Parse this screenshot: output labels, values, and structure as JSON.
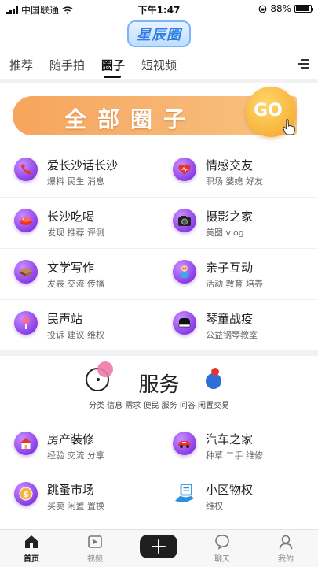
{
  "status": {
    "carrier": "中国联通",
    "time": "下午1:47",
    "battery": "88%",
    "battery_level": 0.88
  },
  "app": {
    "logo_text": "星辰圈"
  },
  "tabs": [
    {
      "label": "推荐"
    },
    {
      "label": "随手拍"
    },
    {
      "label": "圈子"
    },
    {
      "label": "短视频"
    }
  ],
  "active_tab": "圈子",
  "banner": {
    "title": "全部圈子",
    "go_label": "GO"
  },
  "circles": [
    {
      "title": "爱长沙话长沙",
      "tags": "爆料 民生 消息",
      "icon": "phone-icon"
    },
    {
      "title": "情感交友",
      "tags": "职场 婆媳 好友",
      "icon": "heart-icon"
    },
    {
      "title": "长沙吃喝",
      "tags": "发现 推荐 评测",
      "icon": "food-icon"
    },
    {
      "title": "摄影之家",
      "tags": "美图 vlog",
      "icon": "camera-icon"
    },
    {
      "title": "文学写作",
      "tags": "发表 交流 传播",
      "icon": "book-icon"
    },
    {
      "title": "亲子互动",
      "tags": "活动 教育 培养",
      "icon": "child-icon"
    },
    {
      "title": "民声站",
      "tags": "投诉 建议 维权",
      "icon": "microphone-icon"
    },
    {
      "title": "琴童战疫",
      "tags": "公益钢琴教室",
      "icon": "piano-icon"
    }
  ],
  "service": {
    "title": "服务",
    "subtitle": "分类 信息 需求 便民 服务 问答 闲置交易"
  },
  "services": [
    {
      "title": "房产装修",
      "tags": "经验 交流 分享",
      "icon": "house-icon"
    },
    {
      "title": "汽车之家",
      "tags": "种草 二手 维修",
      "icon": "car-icon"
    },
    {
      "title": "跳蚤市场",
      "tags": "买卖 闲置 置换",
      "icon": "coin-icon"
    },
    {
      "title": "小区物权",
      "tags": "维权",
      "icon": "property-icon"
    }
  ],
  "bottom_nav": [
    {
      "label": "首页",
      "icon": "home-icon"
    },
    {
      "label": "视频",
      "icon": "video-icon"
    },
    {
      "label": "",
      "icon": "plus-icon"
    },
    {
      "label": "聊天",
      "icon": "chat-icon"
    },
    {
      "label": "我的",
      "icon": "profile-icon"
    }
  ],
  "colors": {
    "accent_purple": "#8a3fe6",
    "banner_orange": "#f6a55c",
    "go_yellow": "#f7b33c",
    "service_pink": "#f07aa8",
    "service_blue": "#2d6fd6",
    "service_red": "#e8342e"
  }
}
